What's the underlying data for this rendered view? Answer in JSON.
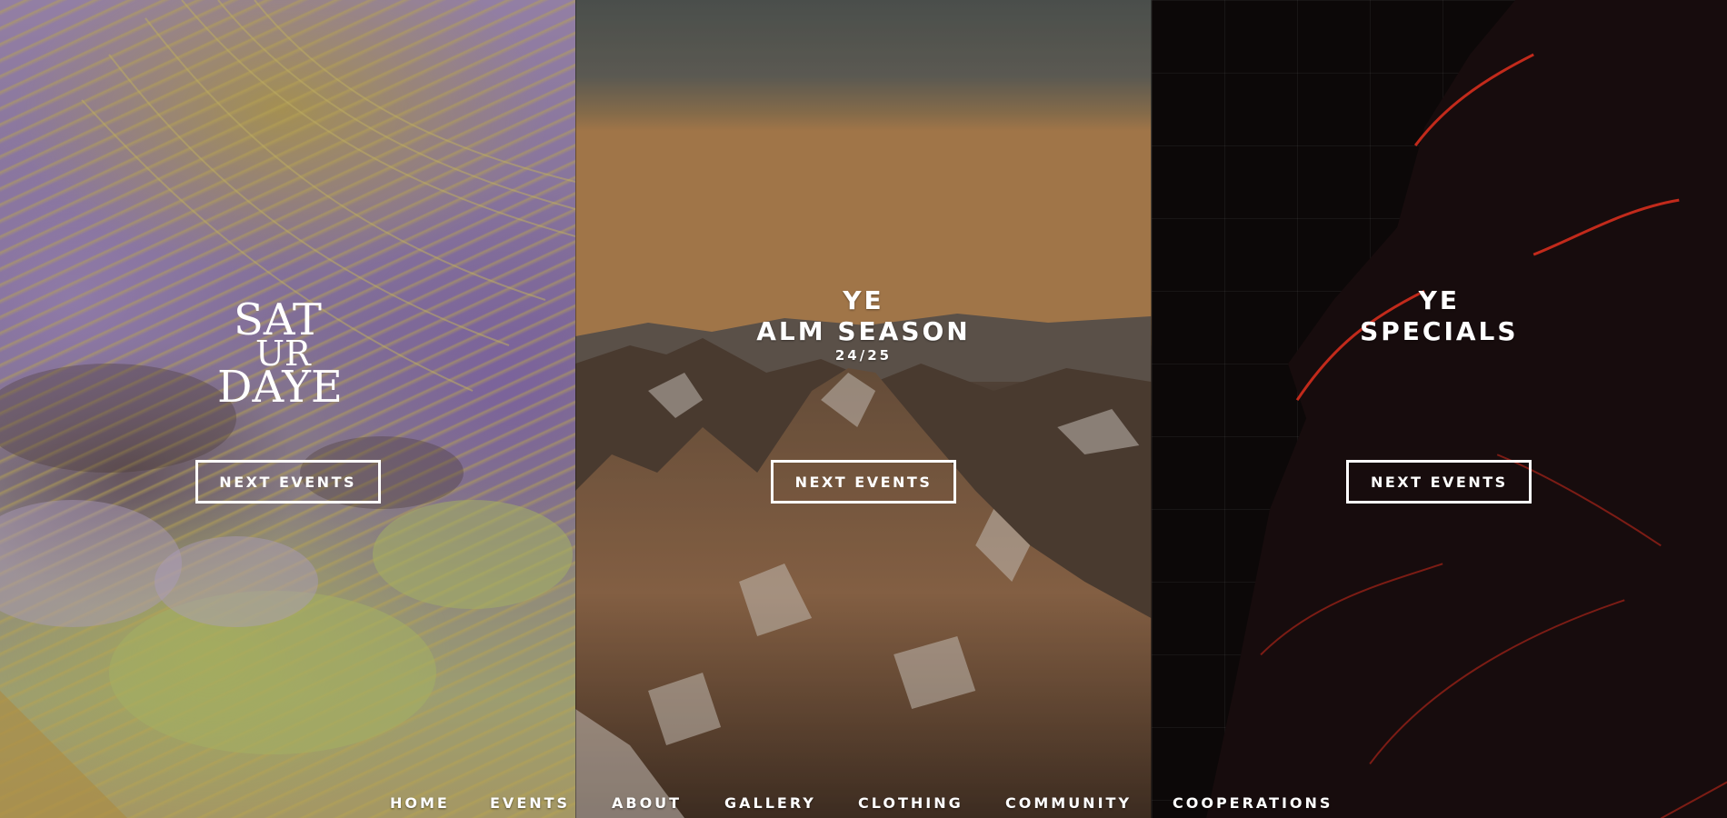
{
  "panels": [
    {
      "logo_text": "SATURDAYE",
      "button_label": "NEXT EVENTS"
    },
    {
      "title_line1": "YE",
      "title_line2": "ALM SEASON",
      "subtitle": "24/25",
      "button_label": "NEXT EVENTS"
    },
    {
      "title_line1": "YE",
      "title_line2": "SPECIALS",
      "button_label": "NEXT EVENTS"
    }
  ],
  "nav": {
    "items": [
      "HOME",
      "EVENTS",
      "ABOUT",
      "GALLERY",
      "CLOTHING",
      "COMMUNITY",
      "COOPERATIONS"
    ]
  },
  "colors": {
    "text": "#ffffff",
    "accent_red": "#e0301e"
  }
}
